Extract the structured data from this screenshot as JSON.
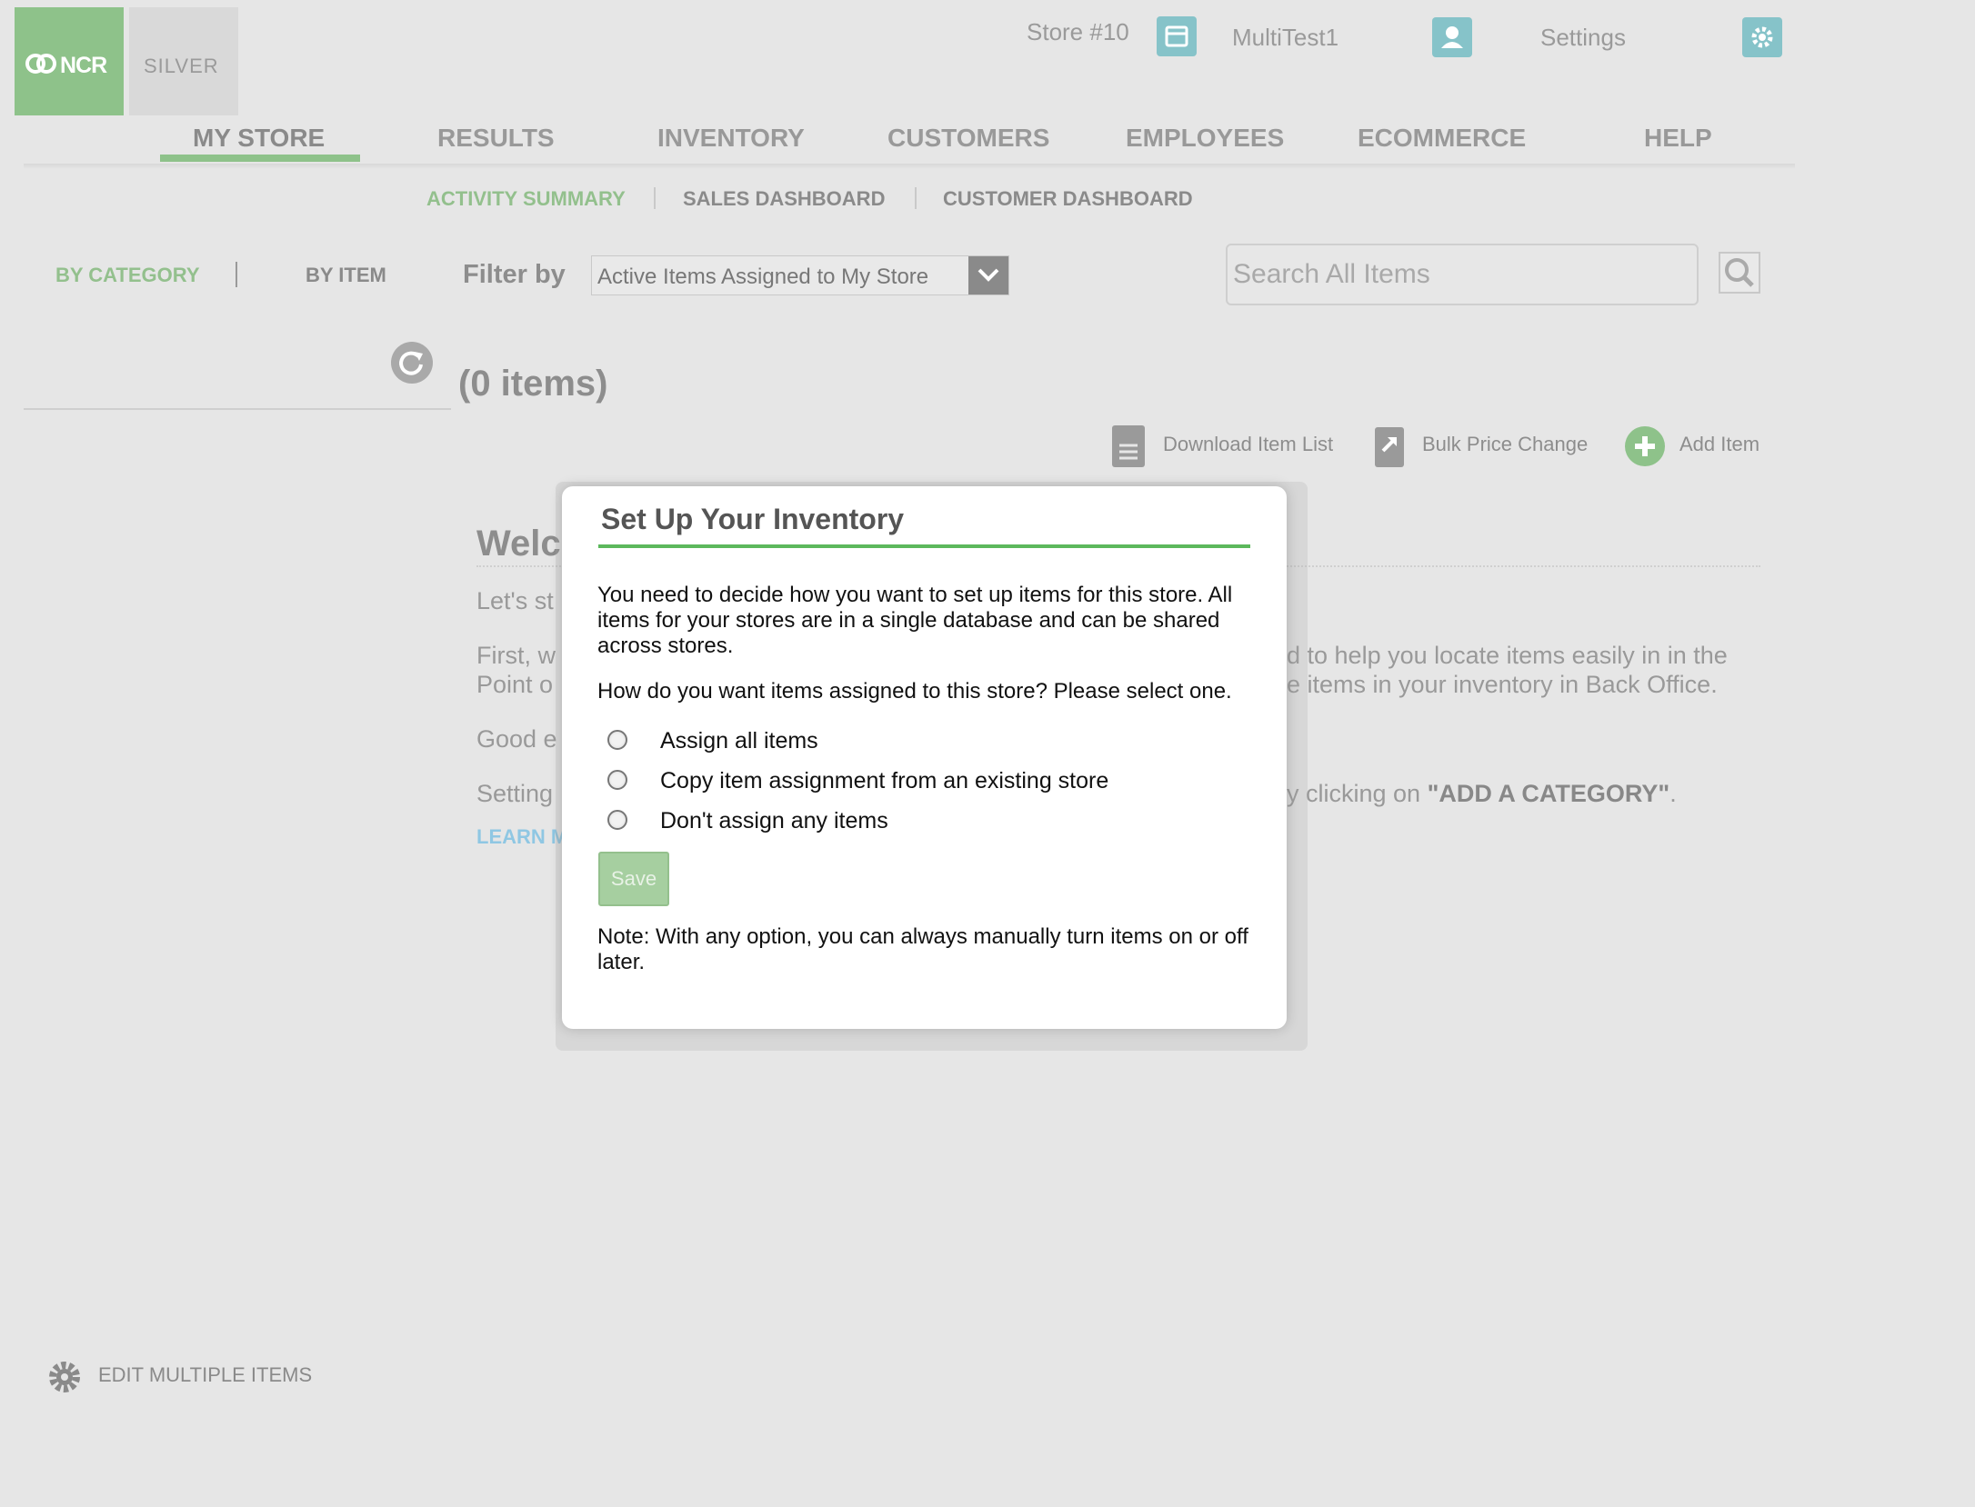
{
  "brand": {
    "ncr_logo": "NCR",
    "silver_logo": "SILVER"
  },
  "topbar": {
    "store": "Store #10",
    "user": "MultiTest1",
    "settings": "Settings"
  },
  "main_nav": [
    "MY STORE",
    "RESULTS",
    "INVENTORY",
    "CUSTOMERS",
    "EMPLOYEES",
    "ECOMMERCE",
    "HELP"
  ],
  "sub_nav": [
    "ACTIVITY SUMMARY",
    "SALES DASHBOARD",
    "CUSTOMER DASHBOARD"
  ],
  "view_toggle": {
    "by_category": "BY CATEGORY",
    "by_item": "BY ITEM"
  },
  "filter": {
    "label": "Filter by",
    "selected": "Active Items Assigned to My Store"
  },
  "search": {
    "placeholder": "Search All Items"
  },
  "items_count": "(0 items)",
  "actions": {
    "download": "Download Item List",
    "bulk": "Bulk Price Change",
    "add": "Add Item"
  },
  "background": {
    "welcome": "Welc",
    "line1": "Let's st",
    "line2a": "First, w",
    "line2b": "Point o",
    "line2c_right": "d to help you locate items easily in in the",
    "line2d_right": "e items in your inventory in Back Office.",
    "line3": "Good e",
    "line4": "Setting",
    "line4_right_pre": "y clicking on ",
    "line4_right_bold": "\"ADD A CATEGORY\"",
    "line4_right_post": ".",
    "learn": "LEARN M"
  },
  "edit_multiple": "EDIT MULTIPLE ITEMS",
  "modal": {
    "title": "Set Up Your Inventory",
    "p1": "You need to decide how you want to set up items for this store. All items for your stores are in a single database and can be shared across stores.",
    "p2": "How do you want items assigned to this store? Please select one.",
    "options": [
      "Assign all items",
      "Copy item assignment from an existing store",
      "Don't assign any items"
    ],
    "save": "Save",
    "note": "Note: With any option, you can always manually turn items on or off later."
  },
  "colors": {
    "accent_green": "#8ec28a",
    "rule_green": "#5cb85c",
    "icon_teal": "#86c3c9",
    "link_blue": "#8fc7e3"
  }
}
